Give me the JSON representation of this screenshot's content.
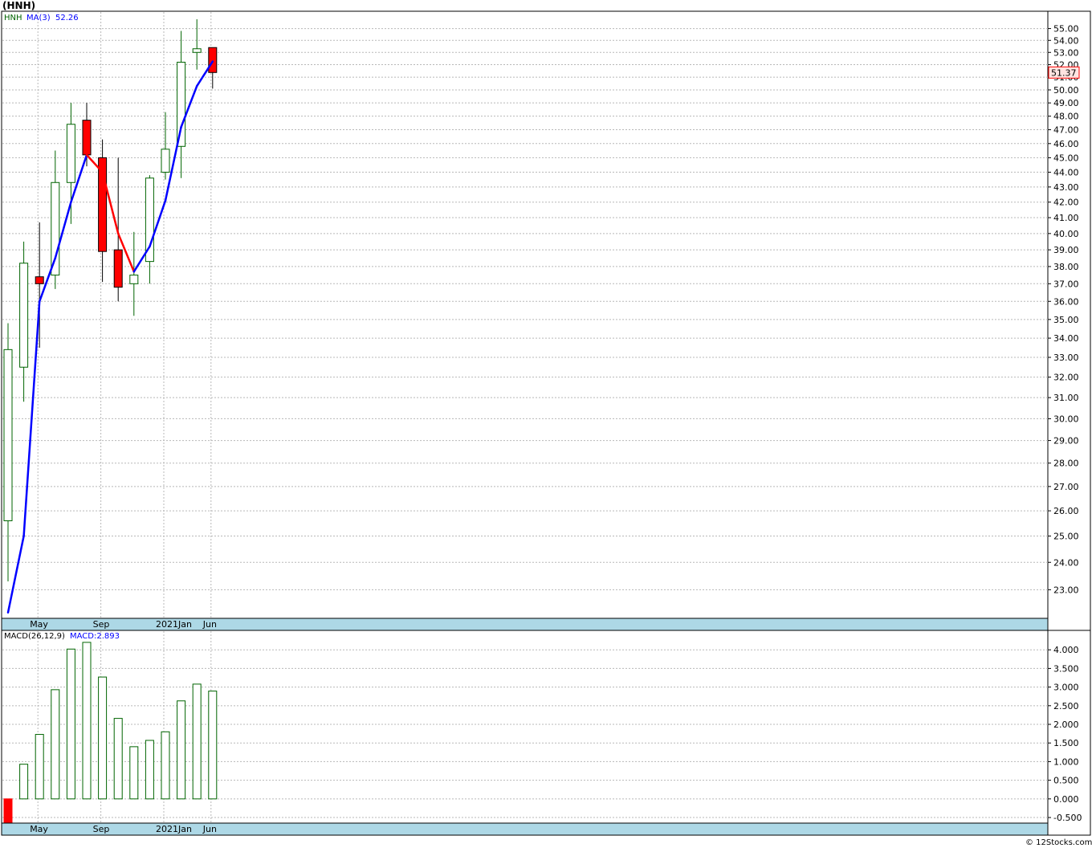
{
  "header": {
    "title": "(HNH)",
    "symbol": "HNH",
    "ma_label": "MA(3)",
    "ma_value": "52.26",
    "last_price": "51.37",
    "macd_label": "MACD(26,12,9)",
    "macd_value_label": "MACD:2.893",
    "credit": "© 12Stocks.com"
  },
  "colors": {
    "up_candle": "#006400",
    "down_candle": "#ff0000",
    "ma_line": "#0000ff",
    "ma_line_down": "#ff0000",
    "grid": "#b8b8b8",
    "axis_strip": "#add8e6",
    "price_tag_bg": "#ffe4e1",
    "price_tag_text": "#ff0000",
    "macd_bar": "#006400",
    "macd_negative": "#ff0000"
  },
  "chart_data": [
    {
      "type": "candlestick",
      "title": "(HNH)",
      "price_axis_ticks": [
        "23.00",
        "24.00",
        "25.00",
        "26.00",
        "27.00",
        "28.00",
        "29.00",
        "30.00",
        "31.00",
        "32.00",
        "33.00",
        "34.00",
        "35.00",
        "36.00",
        "37.00",
        "38.00",
        "39.00",
        "40.00",
        "41.00",
        "42.00",
        "43.00",
        "44.00",
        "45.00",
        "46.00",
        "47.00",
        "48.00",
        "49.00",
        "50.00",
        "51.00",
        "52.00",
        "53.00",
        "54.00",
        "55.00"
      ],
      "x_tick_labels": [
        "May",
        "Sep",
        "2021Jan",
        "Jun"
      ],
      "x_tick_indices": [
        2,
        6,
        10,
        13
      ],
      "ylim": [
        22,
        56.5
      ],
      "scale": "log",
      "candles": [
        {
          "open": 25.6,
          "high": 34.8,
          "low": 23.3,
          "close": 33.4
        },
        {
          "open": 32.5,
          "high": 39.5,
          "low": 30.8,
          "close": 38.2
        },
        {
          "open": 37.4,
          "high": 40.7,
          "low": 33.5,
          "close": 37.0
        },
        {
          "open": 37.5,
          "high": 45.5,
          "low": 36.7,
          "close": 43.3
        },
        {
          "open": 43.3,
          "high": 49.0,
          "low": 40.6,
          "close": 47.4
        },
        {
          "open": 47.7,
          "high": 49.0,
          "low": 44.4,
          "close": 45.2
        },
        {
          "open": 45.0,
          "high": 46.3,
          "low": 37.1,
          "close": 38.9
        },
        {
          "open": 39.0,
          "high": 45.0,
          "low": 36.0,
          "close": 36.8
        },
        {
          "open": 37.0,
          "high": 40.1,
          "low": 35.2,
          "close": 37.5
        },
        {
          "open": 38.3,
          "high": 43.8,
          "low": 37.0,
          "close": 43.6
        },
        {
          "open": 44.0,
          "high": 48.3,
          "low": 43.5,
          "close": 45.6
        },
        {
          "open": 45.8,
          "high": 54.8,
          "low": 43.6,
          "close": 52.2
        },
        {
          "open": 53.0,
          "high": 55.8,
          "low": 51.6,
          "close": 53.3
        },
        {
          "open": 53.4,
          "high": 53.4,
          "low": 50.1,
          "close": 51.37
        }
      ],
      "series": [
        {
          "name": "MA(3)",
          "values": [
            22.2,
            25.0,
            36.0,
            38.5,
            42.0,
            45.2,
            44.0,
            40.0,
            37.7,
            39.2,
            42.1,
            47.2,
            50.3,
            52.26
          ]
        }
      ]
    },
    {
      "type": "bar",
      "title": "MACD(26,12,9)",
      "y_axis_ticks": [
        "-0.500",
        "0.000",
        "0.500",
        "1.000",
        "1.500",
        "2.000",
        "2.500",
        "3.000",
        "3.500",
        "4.000"
      ],
      "x_tick_labels": [
        "May",
        "Sep",
        "2021Jan",
        "Jun"
      ],
      "ylim": [
        -0.65,
        4.5
      ],
      "series": [
        {
          "name": "MACD",
          "values": [
            -0.7,
            0.93,
            1.73,
            2.93,
            4.02,
            4.2,
            3.27,
            2.16,
            1.4,
            1.57,
            1.8,
            2.63,
            3.08,
            2.893
          ]
        }
      ]
    }
  ]
}
